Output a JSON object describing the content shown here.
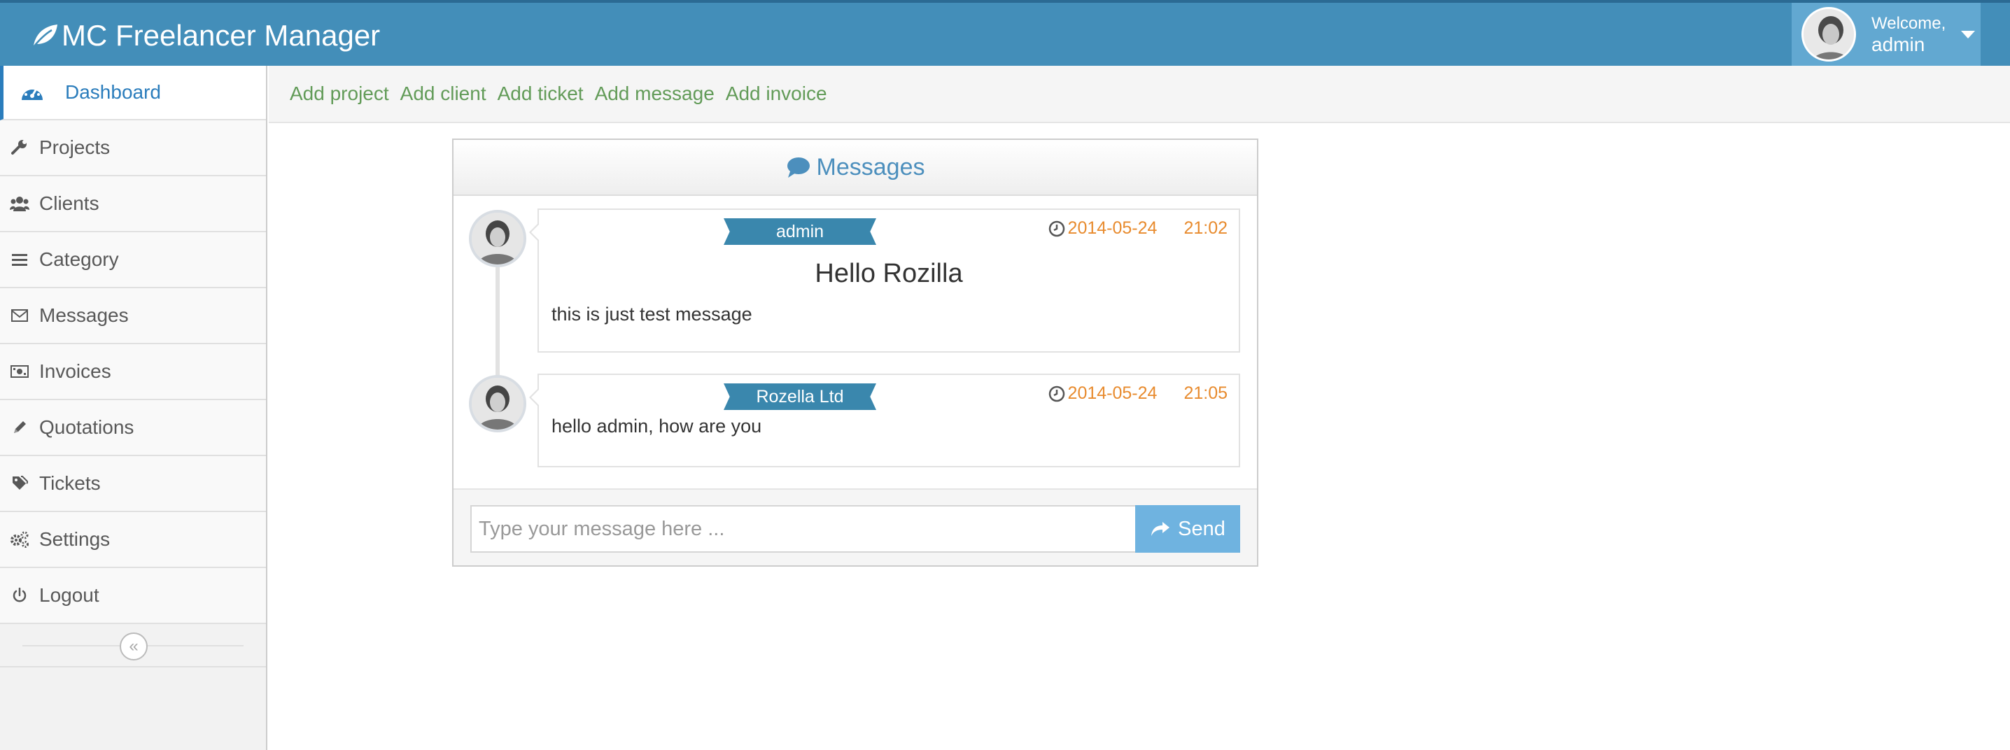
{
  "header": {
    "title": "MC Freelancer Manager",
    "welcome": "Welcome,",
    "username": "admin"
  },
  "sidebar": {
    "items": [
      {
        "label": "Dashboard",
        "icon": "tachometer-icon",
        "active": true
      },
      {
        "label": "Projects",
        "icon": "wrench-icon"
      },
      {
        "label": "Clients",
        "icon": "users-icon"
      },
      {
        "label": "Category",
        "icon": "list-icon"
      },
      {
        "label": "Messages",
        "icon": "envelope-icon"
      },
      {
        "label": "Invoices",
        "icon": "money-icon"
      },
      {
        "label": "Quotations",
        "icon": "pencil-icon"
      },
      {
        "label": "Tickets",
        "icon": "tags-icon"
      },
      {
        "label": "Settings",
        "icon": "cogs-icon"
      },
      {
        "label": "Logout",
        "icon": "power-icon"
      }
    ],
    "collapse_glyph": "«"
  },
  "breadcrumbs": {
    "links": [
      "Add project",
      "Add client",
      "Add ticket",
      "Add message",
      "Add invoice"
    ]
  },
  "messages_widget": {
    "title": "Messages",
    "messages": [
      {
        "sender": "admin",
        "date": "2014-05-24",
        "time": "21:02",
        "subject": "Hello Rozilla",
        "body": "this is just test message"
      },
      {
        "sender": "Rozella Ltd",
        "date": "2014-05-24",
        "time": "21:05",
        "subject": "",
        "body": "hello admin, how are you"
      }
    ],
    "input_placeholder": "Type your message here ...",
    "send_label": "Send"
  },
  "colors": {
    "header_bg": "#438eb9",
    "user_box_bg": "#62a8d1",
    "active_nav": "#2b7dbc",
    "link_green": "#629b58",
    "ribbon": "#3a87ad",
    "time_orange": "#e88b2e",
    "send_button": "#6fb3e0"
  }
}
